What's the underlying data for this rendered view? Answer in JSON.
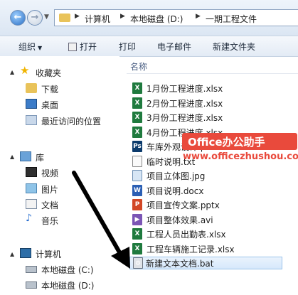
{
  "address": {
    "breadcrumbs": [
      "计算机",
      "本地磁盘 (D:)",
      "一期工程文件"
    ]
  },
  "toolbar": {
    "organize": "组织",
    "open": "打开",
    "print": "打印",
    "email": "电子邮件",
    "new_folder": "新建文件夹"
  },
  "sidebar": {
    "favorites": "收藏夹",
    "downloads": "下载",
    "desktop": "桌面",
    "recent": "最近访问的位置",
    "libraries": "库",
    "videos": "视频",
    "pictures": "图片",
    "documents": "文档",
    "music": "音乐",
    "computer": "计算机",
    "disk_c": "本地磁盘 (C:)",
    "disk_d": "本地磁盘 (D:)"
  },
  "list": {
    "column_name": "名称",
    "files": [
      {
        "name": "1月份工程进度.xlsx",
        "type": "xls"
      },
      {
        "name": "2月份工程进度.xlsx",
        "type": "xls"
      },
      {
        "name": "3月份工程进度.xlsx",
        "type": "xls"
      },
      {
        "name": "4月份工程进度.xlsx",
        "type": "xls"
      },
      {
        "name": "车库外观设计.psd",
        "type": "psd"
      },
      {
        "name": "临时说明.txt",
        "type": "txt"
      },
      {
        "name": "项目立体图.jpg",
        "type": "jpg"
      },
      {
        "name": "项目说明.docx",
        "type": "doc"
      },
      {
        "name": "项目宣传文案.pptx",
        "type": "ppt"
      },
      {
        "name": "项目整体效果.avi",
        "type": "avi"
      },
      {
        "name": "工程人员出勤表.xlsx",
        "type": "xls"
      },
      {
        "name": "工程车辆施工记录.xlsx",
        "type": "xls"
      },
      {
        "name": "新建文本文档.bat",
        "type": "bat"
      }
    ]
  },
  "watermark": {
    "brand": "Office办公助手",
    "url": "www.officezhushou.com"
  },
  "colors": {
    "accent": "#e94a3c",
    "selection": "#d6e8fb",
    "header_text": "#4d6185"
  }
}
